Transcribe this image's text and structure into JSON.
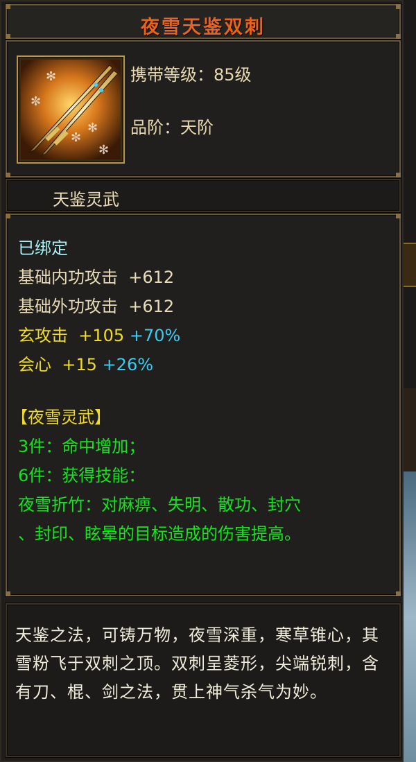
{
  "item": {
    "title": "夜雪天鉴双刺",
    "icon": "twin-daggers-icon",
    "carry_level": "携带等级：85级",
    "grade": "品阶：天阶",
    "subtitle": "天鉴灵武"
  },
  "attributes": {
    "bound": "已绑定",
    "inner_attack": {
      "label": "基础内功攻击",
      "value": "+612"
    },
    "outer_attack": {
      "label": "基础外功攻击",
      "value": "+612"
    },
    "mystic_attack": {
      "label": "玄攻击",
      "value": "+105",
      "pct": "+70%"
    },
    "critical": {
      "label": "会心",
      "value": "+15",
      "pct": "+26%"
    }
  },
  "set": {
    "name": "【夜雪灵武】",
    "bonus3": "3件：命中增加；",
    "bonus6": "6件：获得技能：",
    "skill_line1": "夜雪折竹：对麻痹、失明、散功、封穴",
    "skill_line2": "、封印、眩晕的目标造成的伤害提高。"
  },
  "description": "天鉴之法，可铸万物，夜雪深重，寒草锥心，其雪粉飞于双刺之顶。双刺呈菱形，尖端锐刺，含有刀、棍、剑之法，贯上神气杀气为妙。",
  "colors": {
    "title": "#e8641e",
    "bound": "#a8f0f4",
    "base_stat": "#eadcb8",
    "special_stat": "#f0dc28",
    "percent": "#38ccf0",
    "set_bonus": "#14e41e"
  }
}
